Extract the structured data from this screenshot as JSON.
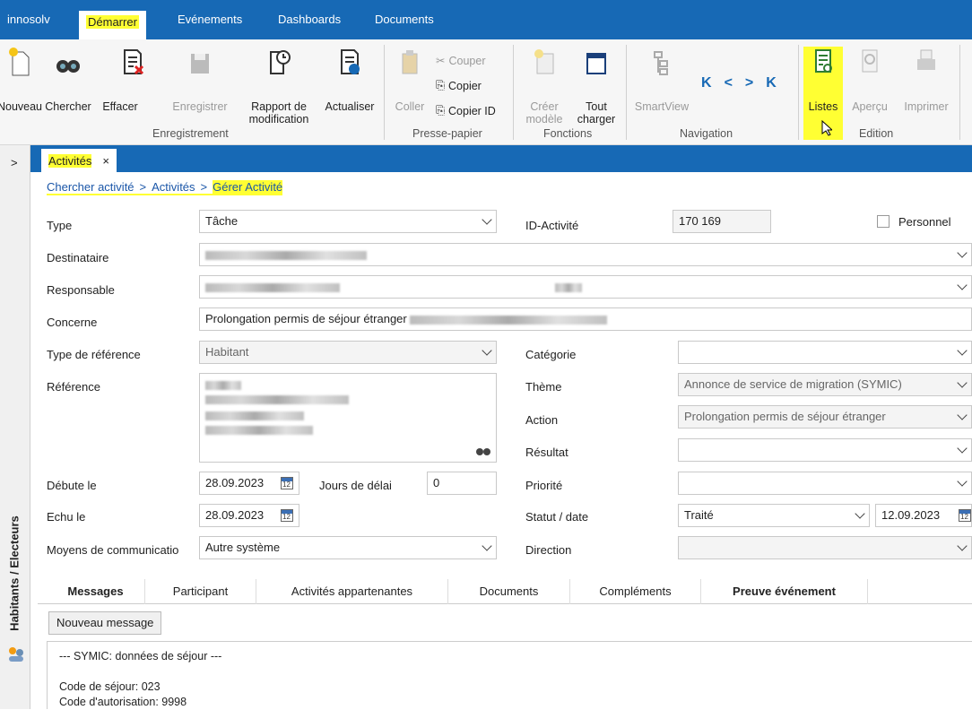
{
  "menubar": {
    "app": "innosolv",
    "items": [
      "Démarrer",
      "Evénements",
      "Dashboards",
      "Documents"
    ]
  },
  "ribbon": {
    "buttons": {
      "nouveau": "Nouveau",
      "chercher": "Chercher",
      "effacer": "Effacer",
      "enregistrer": "Enregistrer",
      "rapport1": "Rapport de",
      "rapport2": "modification",
      "actualiser": "Actualiser",
      "coller": "Coller",
      "couper": "Couper",
      "copier": "Copier",
      "copier_id": "Copier ID",
      "creer1": "Créer",
      "creer2": "modèle",
      "tout1": "Tout",
      "tout2": "charger",
      "smartview": "SmartView",
      "listes": "Listes",
      "apercu": "Aperçu",
      "imprimer": "Imprimer"
    },
    "groups": {
      "enregistrement": "Enregistrement",
      "presse": "Presse-papier",
      "fonctions": "Fonctions",
      "navigation": "Navigation",
      "edition": "Edition"
    },
    "nav_glyphs": {
      "first": "K",
      "prev": "<",
      "next": ">",
      "last": "K"
    }
  },
  "sidebar": {
    "collapse": ">",
    "vertical_label": "Habitants / Electeurs"
  },
  "tab": {
    "label": "Activités",
    "close": "×"
  },
  "breadcrumb": [
    "Chercher activité",
    "Activités",
    "Gérer Activité"
  ],
  "breadcrumb_sep": ">",
  "form": {
    "type_label": "Type",
    "type_value": "Tâche",
    "id_label": "ID-Activité",
    "id_value": "170 169",
    "personnel_label": "Personnel",
    "destinataire_label": "Destinataire",
    "responsable_label": "Responsable",
    "concerne_label": "Concerne",
    "concerne_value": "Prolongation permis de séjour étranger",
    "typeref_label": "Type de référence",
    "typeref_value": "Habitant",
    "categorie_label": "Catégorie",
    "reference_label": "Référence",
    "theme_label": "Thème",
    "theme_value": "Annonce de service de migration (SYMIC)",
    "action_label": "Action",
    "action_value": "Prolongation permis de séjour étranger",
    "resultat_label": "Résultat",
    "debute_label": "Débute le",
    "debute_value": "28.09.2023",
    "jours_label": "Jours de délai",
    "jours_value": "0",
    "priorite_label": "Priorité",
    "echu_label": "Echu le",
    "echu_value": "28.09.2023",
    "statut_label": "Statut / date",
    "statut_value": "Traité",
    "statut_date": "12.09.2023",
    "moyens_label": "Moyens de communicatio",
    "moyens_value": "Autre système",
    "direction_label": "Direction"
  },
  "subtabs": [
    "Messages",
    "Participant",
    "Activités appartenantes",
    "Documents",
    "Compléments",
    "Preuve événement"
  ],
  "new_message": "Nouveau message",
  "message_lines": [
    "--- SYMIC: données de séjour ---",
    "",
    "Code de séjour: 023",
    "Code d'autorisation: 9998"
  ],
  "colors": {
    "accent": "#1769b5",
    "highlight": "#ffff33"
  }
}
